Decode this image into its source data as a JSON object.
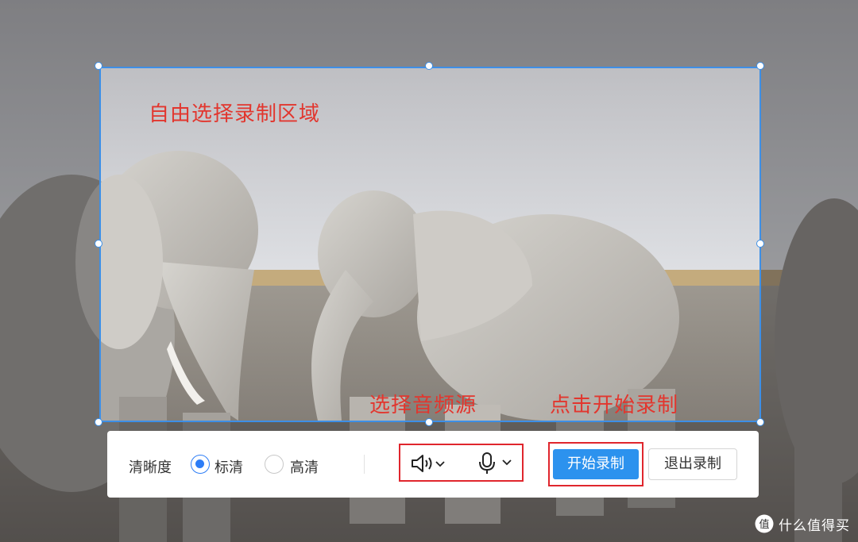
{
  "annotations": {
    "select_region": "自由选择录制区域",
    "select_audio": "选择音频源",
    "start_record": "点击开始录制"
  },
  "toolbar": {
    "quality_label": "清晰度",
    "quality_options": [
      {
        "label": "标清",
        "selected": true
      },
      {
        "label": "高清",
        "selected": false
      }
    ],
    "speaker_icon": "speaker-icon",
    "microphone_icon": "microphone-icon",
    "start_label": "开始录制",
    "exit_label": "退出录制"
  },
  "watermark": {
    "logo": "值",
    "text": "什么值得买"
  },
  "colors": {
    "selection_border": "#3d8fe6",
    "annotation_red": "#e2362e",
    "highlight_red": "#e0262d",
    "primary_button": "#2c92ee",
    "radio_checked": "#2d7df6"
  }
}
